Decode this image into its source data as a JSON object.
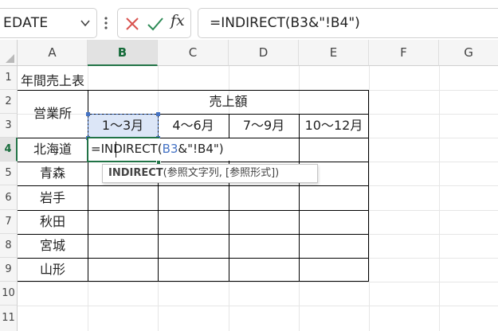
{
  "formula_bar": {
    "name_box": "EDATE",
    "cancel_icon": "close-icon",
    "enter_icon": "check-icon",
    "function_label": "fx",
    "formula": "=INDIRECT(B3&\"!B4\")"
  },
  "columns": [
    "A",
    "B",
    "C",
    "D",
    "E",
    "F",
    "G"
  ],
  "rows": [
    "1",
    "2",
    "3",
    "4",
    "5",
    "6",
    "7",
    "8",
    "9",
    "10",
    "11"
  ],
  "sheet": {
    "a1": "年間売上表",
    "office_header": "営業所",
    "sales_header": "売上額",
    "periods": [
      "1〜3月",
      "4〜6月",
      "7〜9月",
      "10〜12月"
    ],
    "offices": [
      "北海道",
      "青森",
      "岩手",
      "秋田",
      "宮城",
      "山形"
    ],
    "edit": {
      "prefix": "=INDIRECT(",
      "ref": "B3",
      "suffix": "&\"!B4\")"
    }
  },
  "tooltip": {
    "func": "INDIRECT",
    "args": "(参照文字列, [参照形式])"
  },
  "colors": {
    "accent": "#217346",
    "ref_blue": "#4472c4",
    "ref_fill": "#dce6f7"
  }
}
